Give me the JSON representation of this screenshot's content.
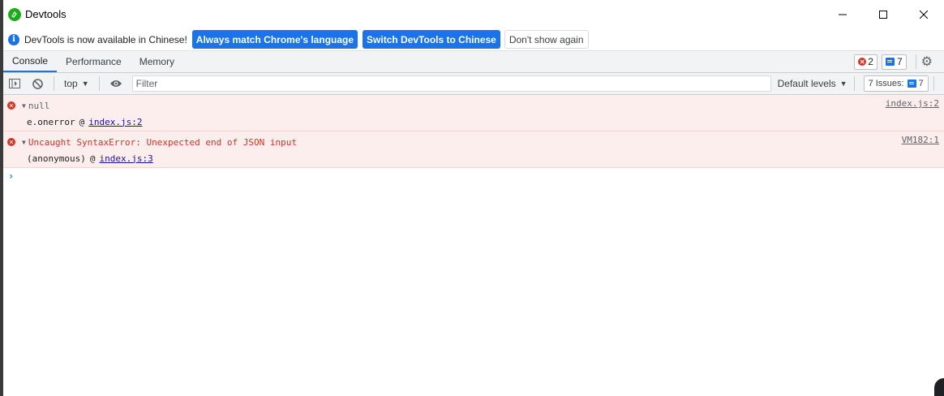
{
  "window": {
    "title": "Devtools",
    "minimize_icon": "minimize-icon",
    "maximize_icon": "maximize-icon",
    "close_icon": "close-icon"
  },
  "infobar": {
    "message": "DevTools is now available in Chinese!",
    "match_language": "Always match Chrome's language",
    "switch_chinese": "Switch DevTools to Chinese",
    "dont_show": "Don't show again"
  },
  "tabs": [
    {
      "label": "Console",
      "active": true
    },
    {
      "label": "Performance",
      "active": false
    },
    {
      "label": "Memory",
      "active": false
    }
  ],
  "counters": {
    "errors": "2",
    "messages": "7"
  },
  "toolbar": {
    "context": "top",
    "filter_placeholder": "Filter",
    "levels": "Default levels",
    "issues_label": "7 Issues:",
    "issues_count": "7"
  },
  "console": {
    "entries": [
      {
        "type": "error",
        "message": "null",
        "source": "index.js:2",
        "trace_fn": "e.onerror",
        "trace_at": "@",
        "trace_link": "index.js:2"
      },
      {
        "type": "error",
        "message": "Uncaught SyntaxError: Unexpected end of JSON input",
        "source": "VM182:1",
        "trace_fn": "(anonymous)",
        "trace_at": "@",
        "trace_link": "index.js:3"
      }
    ],
    "prompt": "›"
  },
  "colors": {
    "accent": "#1a73e8",
    "error": "#d93025",
    "error_bg": "#fdeeee"
  }
}
